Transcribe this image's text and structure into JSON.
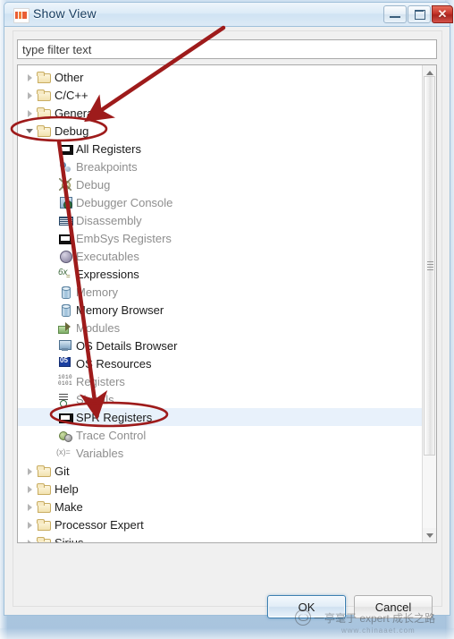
{
  "window": {
    "title": "Show View",
    "app_icon": "nxp-logo-icon",
    "controls": {
      "minimize": "minimize-icon",
      "maximize": "maximize-icon",
      "close": "✕"
    }
  },
  "filter": {
    "placeholder": "type filter text",
    "value": ""
  },
  "tree": {
    "items": [
      {
        "label": "Other",
        "level": 0,
        "icon": "folder",
        "twisty": "closed",
        "dim": false,
        "selected": false
      },
      {
        "label": "C/C++",
        "level": 0,
        "icon": "folder",
        "twisty": "closed",
        "dim": false,
        "selected": false
      },
      {
        "label": "General",
        "level": 0,
        "icon": "folder",
        "twisty": "closed",
        "dim": false,
        "selected": false
      },
      {
        "label": "Debug",
        "level": 0,
        "icon": "folder",
        "twisty": "open",
        "dim": false,
        "selected": false
      },
      {
        "label": "All Registers",
        "level": 1,
        "icon": "reg",
        "twisty": "none",
        "dim": false,
        "selected": false
      },
      {
        "label": "Breakpoints",
        "level": 1,
        "icon": "bp",
        "twisty": "none",
        "dim": true,
        "selected": false
      },
      {
        "label": "Debug",
        "level": 1,
        "icon": "bug",
        "twisty": "none",
        "dim": true,
        "selected": false
      },
      {
        "label": "Debugger Console",
        "level": 1,
        "icon": "console",
        "twisty": "none",
        "dim": true,
        "selected": false
      },
      {
        "label": "Disassembly",
        "level": 1,
        "icon": "disasm",
        "twisty": "none",
        "dim": true,
        "selected": false
      },
      {
        "label": "EmbSys Registers",
        "level": 1,
        "icon": "reg",
        "twisty": "none",
        "dim": true,
        "selected": false
      },
      {
        "label": "Executables",
        "level": 1,
        "icon": "exe",
        "twisty": "none",
        "dim": true,
        "selected": false
      },
      {
        "label": "Expressions",
        "level": 1,
        "icon": "expr",
        "twisty": "none",
        "dim": false,
        "selected": false
      },
      {
        "label": "Memory",
        "level": 1,
        "icon": "mem",
        "twisty": "none",
        "dim": true,
        "selected": false
      },
      {
        "label": "Memory Browser",
        "level": 1,
        "icon": "mem",
        "twisty": "none",
        "dim": false,
        "selected": false
      },
      {
        "label": "Modules",
        "level": 1,
        "icon": "mod",
        "twisty": "none",
        "dim": true,
        "selected": false
      },
      {
        "label": "OS Details Browser",
        "level": 1,
        "icon": "osd",
        "twisty": "none",
        "dim": false,
        "selected": false
      },
      {
        "label": "OS Resources",
        "level": 1,
        "icon": "osr",
        "twisty": "none",
        "dim": false,
        "selected": false
      },
      {
        "label": "Registers",
        "level": 1,
        "icon": "bits",
        "twisty": "none",
        "dim": true,
        "selected": false
      },
      {
        "label": "Signals",
        "level": 1,
        "icon": "sig",
        "twisty": "none",
        "dim": true,
        "selected": false
      },
      {
        "label": "SPR Registers",
        "level": 1,
        "icon": "reg",
        "twisty": "none",
        "dim": false,
        "selected": true
      },
      {
        "label": "Trace Control",
        "level": 1,
        "icon": "trace",
        "twisty": "none",
        "dim": true,
        "selected": false
      },
      {
        "label": "Variables",
        "level": 1,
        "icon": "varx",
        "twisty": "none",
        "dim": true,
        "selected": false
      },
      {
        "label": "Git",
        "level": 0,
        "icon": "folder",
        "twisty": "closed",
        "dim": false,
        "selected": false
      },
      {
        "label": "Help",
        "level": 0,
        "icon": "folder",
        "twisty": "closed",
        "dim": false,
        "selected": false
      },
      {
        "label": "Make",
        "level": 0,
        "icon": "folder",
        "twisty": "closed",
        "dim": false,
        "selected": false
      },
      {
        "label": "Processor Expert",
        "level": 0,
        "icon": "folder",
        "twisty": "closed",
        "dim": false,
        "selected": false
      },
      {
        "label": "Sirius",
        "level": 0,
        "icon": "folder",
        "twisty": "closed",
        "dim": false,
        "selected": false
      }
    ]
  },
  "scrollbar": {
    "up_arrow": "scroll-up-icon",
    "down_arrow": "scroll-down-icon"
  },
  "buttons": {
    "ok": "OK",
    "cancel": "Cancel"
  },
  "annotations": {
    "color": "#9e1b1b",
    "ellipse_debug_label": "Debug",
    "ellipse_spr_label": "SPR Registers",
    "arrow_count": 2
  },
  "watermark": {
    "text": "一亭毫于 expert 成长之路",
    "url": "www.chinaaet.com"
  }
}
